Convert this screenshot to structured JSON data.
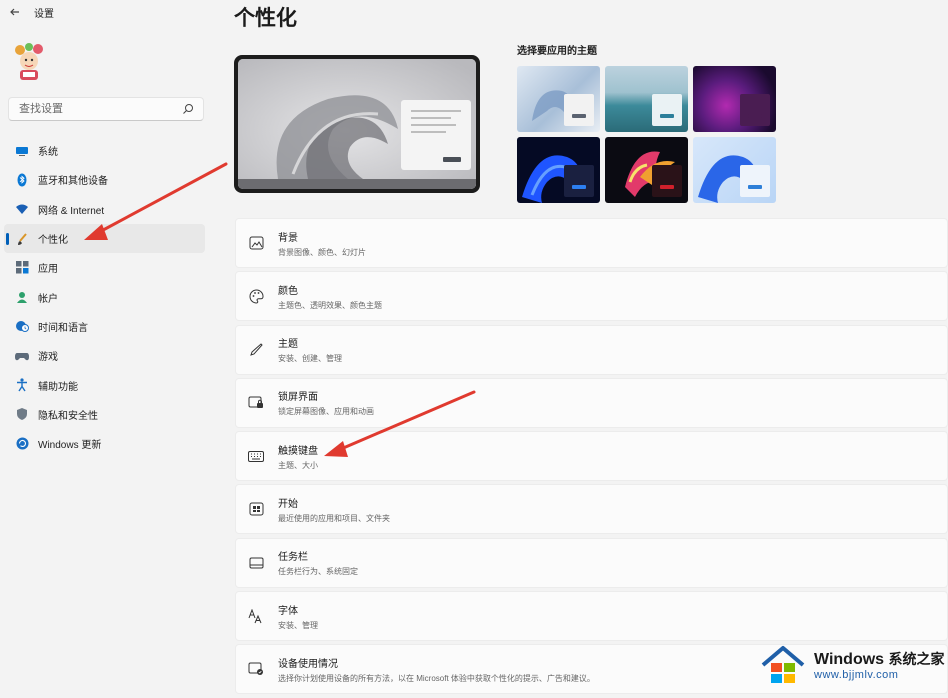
{
  "app": {
    "title": "设置",
    "back_icon": "back-arrow-icon"
  },
  "search": {
    "placeholder": "查找设置"
  },
  "nav": {
    "items": [
      {
        "label": "系统",
        "icon": "monitor-icon"
      },
      {
        "label": "蓝牙和其他设备",
        "icon": "bluetooth-icon"
      },
      {
        "label": "网络 & Internet",
        "icon": "wifi-icon"
      },
      {
        "label": "个性化",
        "icon": "brush-icon",
        "active": true
      },
      {
        "label": "应用",
        "icon": "apps-icon"
      },
      {
        "label": "帐户",
        "icon": "person-icon"
      },
      {
        "label": "时间和语言",
        "icon": "globe-clock-icon"
      },
      {
        "label": "游戏",
        "icon": "gamepad-icon"
      },
      {
        "label": "辅助功能",
        "icon": "accessibility-icon"
      },
      {
        "label": "隐私和安全性",
        "icon": "shield-icon"
      },
      {
        "label": "Windows 更新",
        "icon": "update-icon"
      }
    ]
  },
  "main": {
    "title": "个性化",
    "themes_label": "选择要应用的主题",
    "settings": [
      {
        "title": "背景",
        "subtitle": "背景图像、颜色、幻灯片",
        "icon": "picture-icon"
      },
      {
        "title": "颜色",
        "subtitle": "主题色、透明效果、颜色主题",
        "icon": "palette-icon"
      },
      {
        "title": "主题",
        "subtitle": "安装、创建、管理",
        "icon": "pen-icon"
      },
      {
        "title": "锁屏界面",
        "subtitle": "锁定屏幕图像、应用和动画",
        "icon": "lock-screen-icon"
      },
      {
        "title": "触摸键盘",
        "subtitle": "主题、大小",
        "icon": "keyboard-icon"
      },
      {
        "title": "开始",
        "subtitle": "最近使用的应用和项目、文件夹",
        "icon": "start-icon"
      },
      {
        "title": "任务栏",
        "subtitle": "任务栏行为、系统固定",
        "icon": "taskbar-icon"
      },
      {
        "title": "字体",
        "subtitle": "安装、管理",
        "icon": "font-icon"
      },
      {
        "title": "设备使用情况",
        "subtitle": "选择你计划使用设备的所有方法，以在 Microsoft 体验中获取个性化的提示、广告和建议。",
        "icon": "device-usage-icon"
      }
    ]
  },
  "colors": {
    "accent": "#005fb8",
    "annotation_arrow": "#e03a2f"
  },
  "watermark": {
    "brand": "Windows",
    "brand_cn": "系统之家",
    "url": "www.bjjmlv.com"
  }
}
